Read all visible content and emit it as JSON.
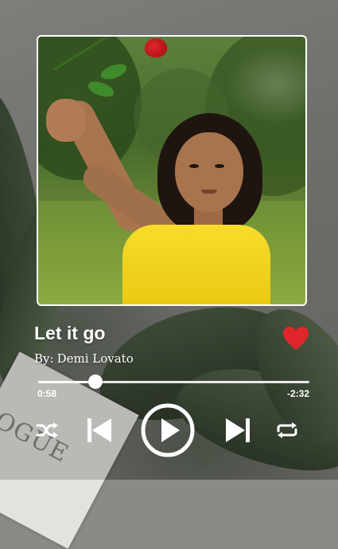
{
  "track": {
    "title": "Let it go",
    "artist_prefix": "By:",
    "artist": "Demi Lovato",
    "liked": true
  },
  "playback": {
    "elapsed": "0:58",
    "remaining": "-2:32",
    "progress": 0.21,
    "state": "paused"
  },
  "controls": {
    "shuffle_icon": "shuffle-icon",
    "previous_icon": "skip-previous-icon",
    "play_icon": "play-icon",
    "next_icon": "skip-next-icon",
    "repeat_icon": "repeat-icon",
    "heart_icon": "heart-icon"
  },
  "background": {
    "magazine_text": "OGUE"
  },
  "colors": {
    "heart": "#e0262a",
    "text": "#ffffff",
    "track_bar": "#e9e9e9"
  }
}
